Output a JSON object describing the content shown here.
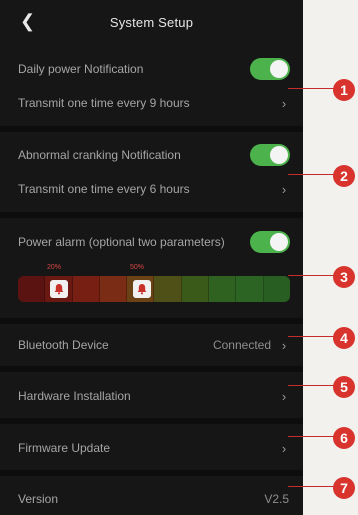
{
  "header": {
    "back_icon": "chevron-left-icon",
    "title": "System Setup"
  },
  "daily": {
    "label": "Daily power Notification",
    "toggle_on": true,
    "interval_label": "Transmit one time every 9 hours"
  },
  "abnormal": {
    "label": "Abnormal cranking Notification",
    "toggle_on": true,
    "interval_label": "Transmit one time every 6 hours"
  },
  "power_alarm": {
    "label": "Power alarm (optional two parameters)",
    "toggle_on": true,
    "markers": [
      {
        "percent": "20%",
        "icon": "bell-icon"
      },
      {
        "percent": "50%",
        "icon": "bell-icon"
      }
    ],
    "scale_colors": [
      "#5a1310",
      "#6a1812",
      "#761f12",
      "#7a2c14",
      "#6a4216",
      "#4e5018",
      "#3a5a1a",
      "#2f6220",
      "#2c6424",
      "#285e22"
    ]
  },
  "bluetooth": {
    "label": "Bluetooth Device",
    "value": "Connected"
  },
  "hardware": {
    "label": "Hardware Installation"
  },
  "firmware": {
    "label": "Firmware Update"
  },
  "version": {
    "label": "Version",
    "value": "V2.5"
  },
  "callouts": [
    "1",
    "2",
    "3",
    "4",
    "5",
    "6",
    "7"
  ],
  "colors": {
    "toggle_on": "#4cb24c",
    "callout": "#d8332c",
    "background": "#161616"
  }
}
